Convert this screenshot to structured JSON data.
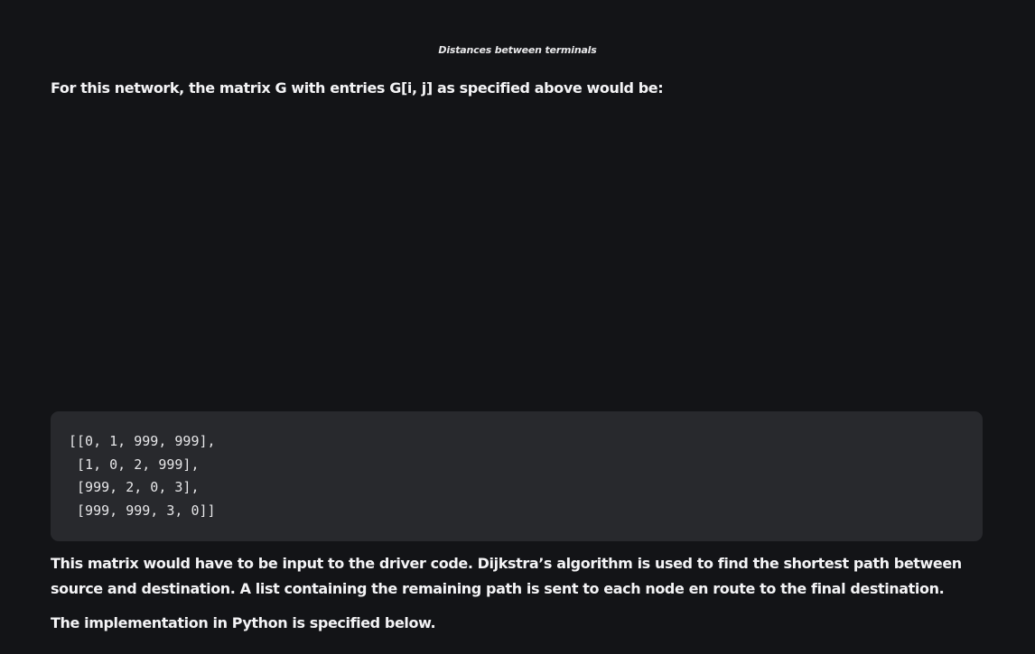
{
  "figure": {
    "caption": "Distances between terminals"
  },
  "content": {
    "intro_paragraph": "For this network, the matrix G with entries G[i, j] as specified above would be:",
    "code_block": {
      "language": "python",
      "text": "[[0, 1, 999, 999],\n [1, 0, 2, 999],\n [999, 2, 0, 3],\n [999, 999, 3, 0]]"
    },
    "explanation_paragraph": "This matrix would have to be input to the driver code. Dijkstra’s algorithm is used to find the shortest path between source and destination. A list containing the remaining path is sent to each node en route to the final destination.",
    "implementation_paragraph": "The implementation in Python is specified below."
  },
  "colors": {
    "page_background": "#131417",
    "code_background": "#28292d",
    "text": "#f4f4f6"
  }
}
